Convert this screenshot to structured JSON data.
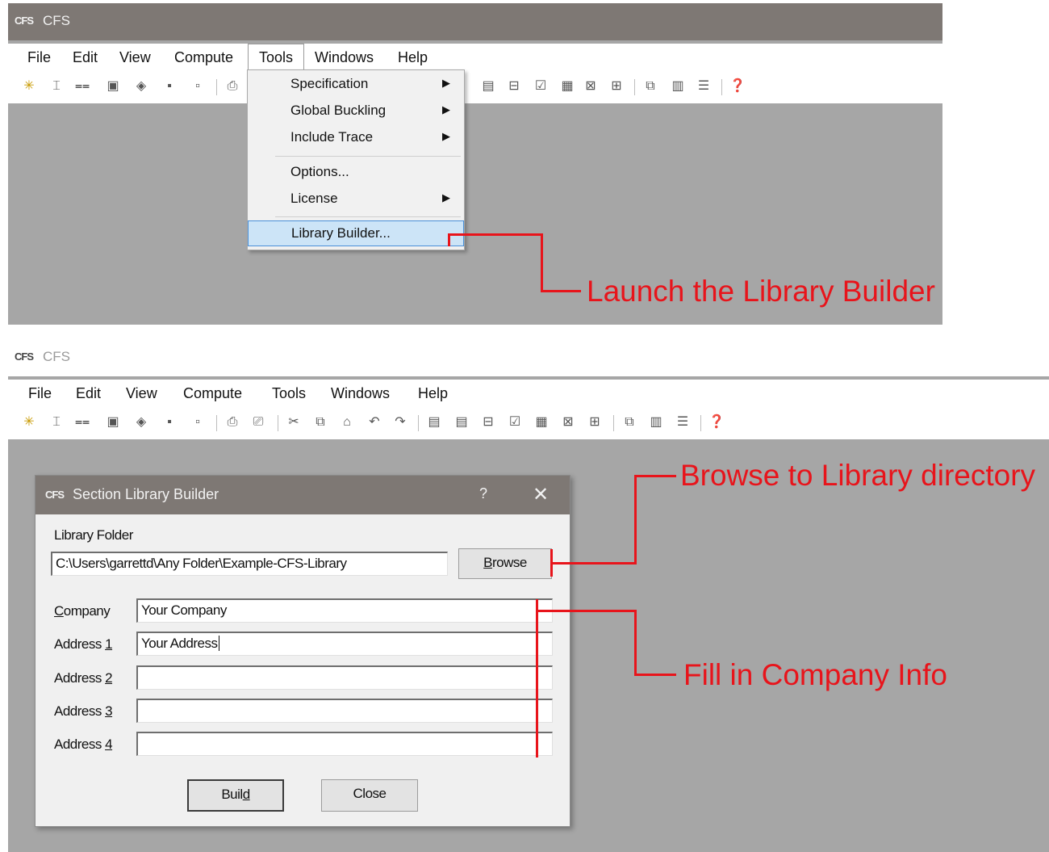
{
  "top_window": {
    "title": "CFS",
    "logo_text": "CFS",
    "menu": [
      "File",
      "Edit",
      "View",
      "Compute",
      "Tools",
      "Windows",
      "Help"
    ],
    "tools_menu": {
      "items": [
        {
          "label": "Specification",
          "submenu": true
        },
        {
          "label": "Global Buckling",
          "submenu": true
        },
        {
          "label": "Include Trace",
          "submenu": true
        },
        {
          "label": "Options...",
          "submenu": false
        },
        {
          "label": "License",
          "submenu": true
        },
        {
          "label": "Library Builder...",
          "submenu": false,
          "highlighted": true
        }
      ]
    },
    "annotation": "Launch the Library Builder"
  },
  "bottom_window": {
    "title": "CFS",
    "logo_text": "CFS",
    "menu": [
      "File",
      "Edit",
      "View",
      "Compute",
      "Tools",
      "Windows",
      "Help"
    ],
    "dialog": {
      "logo_text": "CFS",
      "title": "Section Library Builder",
      "help_glyph": "?",
      "close_glyph": "✕",
      "library_folder_label": "Library Folder",
      "library_folder_value": "C:\\Users\\garrettd\\Any Folder\\Example-CFS-Library",
      "browse_label": {
        "pre": "",
        "u": "B",
        "post": "rowse"
      },
      "company_label": {
        "pre": "",
        "u": "C",
        "post": "ompany"
      },
      "company_value": "Your Company",
      "address1_label": {
        "pre": "Address ",
        "u": "1",
        "post": ""
      },
      "address1_value": "Your Address",
      "address2_label": {
        "pre": "Address ",
        "u": "2",
        "post": ""
      },
      "address2_value": "",
      "address3_label": {
        "pre": "Address ",
        "u": "3",
        "post": ""
      },
      "address3_value": "",
      "address4_label": {
        "pre": "Address ",
        "u": "4",
        "post": ""
      },
      "address4_value": "",
      "build_label": {
        "pre": "Buil",
        "u": "d",
        "post": ""
      },
      "close_label": "Close"
    },
    "annotations": {
      "browse": "Browse to Library directory",
      "company": "Fill in Company Info"
    }
  },
  "icons": {
    "toolbar": [
      "new-icon",
      "section-icon",
      "trace-icon",
      "open-icon",
      "open-template-icon",
      "save-icon",
      "save-as-icon",
      "print-preview-icon",
      "print-icon",
      "cut-icon",
      "copy-icon",
      "paste-icon",
      "undo-icon",
      "redo-icon",
      "properties-icon",
      "effective-properties-icon",
      "buckling-icon",
      "check-icon",
      "report-icon",
      "chart-icon",
      "chart2-icon",
      "cascade-icon",
      "tile-vertical-icon",
      "tile-horizontal-icon",
      "help-icon"
    ]
  },
  "colors": {
    "annotation": "#e8141b",
    "titlebar": "#7e7874",
    "workspace": "#a6a6a6",
    "highlight": "#cce4f7"
  }
}
